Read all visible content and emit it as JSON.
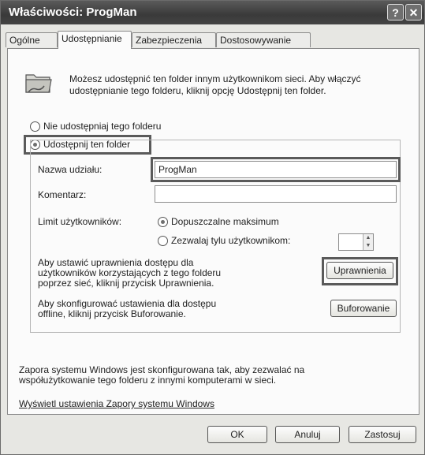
{
  "window": {
    "title": "Właściwości: ProgMan",
    "help_label": "?",
    "close_label": "✕"
  },
  "tabs": [
    {
      "label": "Ogólne"
    },
    {
      "label": "Udostępnianie"
    },
    {
      "label": "Zabezpieczenia"
    },
    {
      "label": "Dostosowywanie"
    }
  ],
  "intro": "Możesz udostępnić ten folder innym użytkownikom sieci. Aby włączyć udostępnianie tego folderu, kliknij opcję Udostępnij ten folder.",
  "share_options": {
    "no_share_label": "Nie udostępniaj tego folderu",
    "share_label": "Udostępnij ten folder",
    "selected": "share"
  },
  "fields": {
    "share_name_label": "Nazwa udziału:",
    "share_name_value": "ProgMan",
    "comment_label": "Komentarz:",
    "comment_value": ""
  },
  "user_limit": {
    "label": "Limit użytkowników:",
    "max_label": "Dopuszczalne maksimum",
    "allow_label": "Zezwalaj tylu użytkownikom:",
    "selected": "max"
  },
  "permissions": {
    "text": "Aby ustawić uprawnienia dostępu dla użytkowników korzystających z tego folderu poprzez sieć, kliknij przycisk Uprawnienia.",
    "button_label": "Uprawnienia"
  },
  "caching": {
    "text": "Aby skonfigurować ustawienia dla dostępu offline, kliknij przycisk Buforowanie.",
    "button_label": "Buforowanie"
  },
  "firewall": {
    "text": "Zapora systemu Windows jest skonfigurowana tak, aby zezwalać na współużytkowanie tego folderu z innymi komputerami w sieci.",
    "link_label": "Wyświetl ustawienia Zapory systemu Windows"
  },
  "footer": {
    "ok_label": "OK",
    "cancel_label": "Anuluj",
    "apply_label": "Zastosuj"
  },
  "colors": {
    "titlebar": "#3a3a3a",
    "highlight_border": "#5a5a5a",
    "panel": "#fbfbfb"
  }
}
